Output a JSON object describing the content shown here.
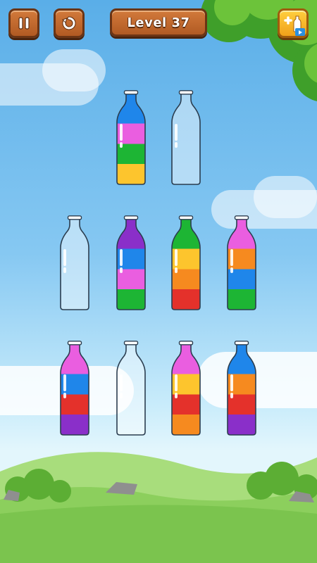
{
  "toolbar": {
    "level_label": "Level 37",
    "pause_icon": "pause-icon",
    "restart_icon": "restart-icon",
    "add_bottle_icon": "add-bottle-icon"
  },
  "colors": {
    "blue": "#1f86ea",
    "pink": "#ea5ee0",
    "green": "#1db534",
    "yellow": "#fdc52d",
    "purple": "#8a2fc9",
    "orange": "#f68a1f",
    "red": "#e4312b"
  },
  "bottles": [
    {
      "row": 1,
      "layers": [
        "yellow",
        "green",
        "pink",
        "blue"
      ]
    },
    {
      "row": 1,
      "layers": []
    },
    {
      "row": 2,
      "layers": []
    },
    {
      "row": 2,
      "layers": [
        "green",
        "pink",
        "blue",
        "purple"
      ]
    },
    {
      "row": 2,
      "layers": [
        "red",
        "orange",
        "yellow",
        "green"
      ]
    },
    {
      "row": 2,
      "layers": [
        "green",
        "blue",
        "orange",
        "pink"
      ]
    },
    {
      "row": 3,
      "layers": [
        "purple",
        "red",
        "blue",
        "pink"
      ]
    },
    {
      "row": 3,
      "layers": []
    },
    {
      "row": 3,
      "layers": [
        "orange",
        "red",
        "yellow",
        "pink"
      ]
    },
    {
      "row": 3,
      "layers": [
        "purple",
        "red",
        "orange",
        "blue"
      ]
    }
  ]
}
